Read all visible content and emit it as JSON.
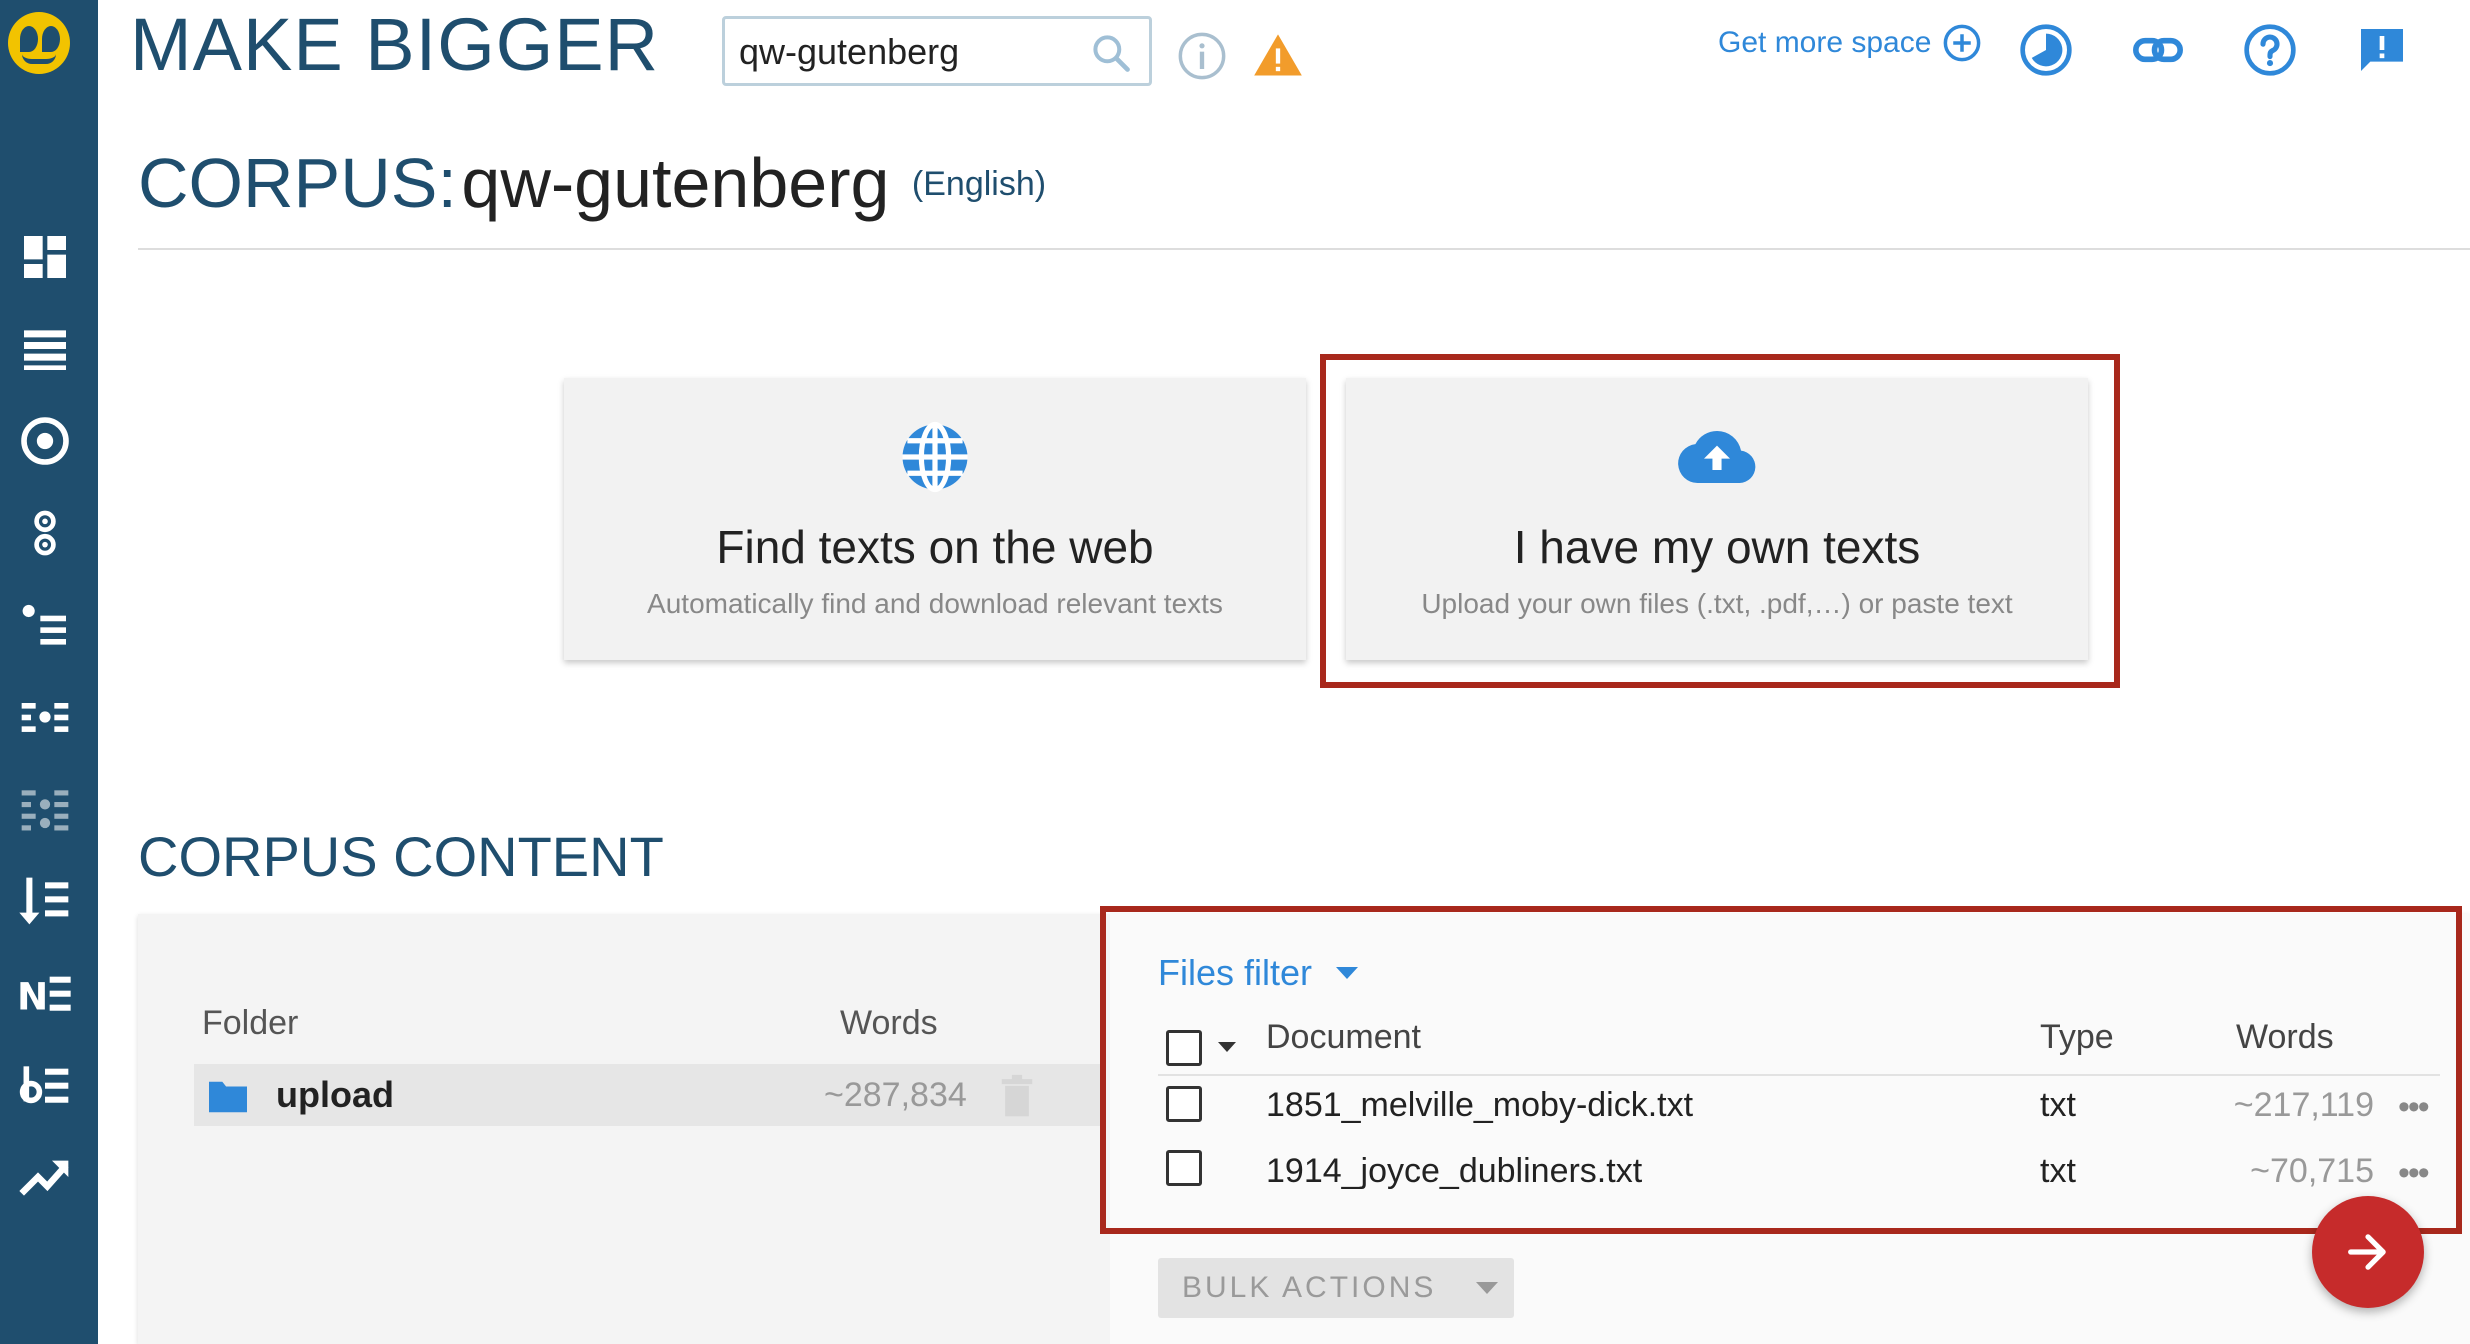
{
  "header": {
    "title": "MAKE BIGGER",
    "search_value": "qw-gutenberg",
    "get_more_space": "Get more space"
  },
  "corpus": {
    "title_prefix": "CORPUS:",
    "name": "qw-gutenberg",
    "language": "(English)"
  },
  "cards": [
    {
      "title": "Find texts on the web",
      "subtitle": "Automatically find and download relevant texts",
      "icon": "globe-icon"
    },
    {
      "title": "I have my own texts",
      "subtitle": "Upload your own files (.txt, .pdf,…) or paste text",
      "icon": "cloud-upload-icon"
    }
  ],
  "content": {
    "section_title": "CORPUS CONTENT",
    "folder_header": "Folder",
    "words_header": "Words",
    "folders": [
      {
        "name": "upload",
        "words": "~287,834"
      }
    ],
    "files_filter": "Files filter",
    "columns": {
      "document": "Document",
      "type": "Type",
      "words": "Words"
    },
    "files": [
      {
        "document": "1851_melville_moby-dick.txt",
        "type": "txt",
        "words": "~217,119"
      },
      {
        "document": "1914_joyce_dubliners.txt",
        "type": "txt",
        "words": "~70,715"
      }
    ],
    "bulk_actions": "BULK ACTIONS",
    "row_menu": "•••"
  },
  "colors": {
    "sidebar": "#1f4e6e",
    "accent_blue": "#2f88d9",
    "highlight_red": "#a8281c",
    "fab_red": "#c62b2b",
    "logo_yellow": "#f2c300"
  },
  "sidebar_icons": [
    "dashboard-icon",
    "list-icon",
    "target-icon",
    "two-circles-icon",
    "bullet-list-icon",
    "wordlist-icon",
    "keywords-icon",
    "sort-list-icon",
    "named-entities-icon",
    "numbered-list-icon",
    "trends-icon"
  ]
}
